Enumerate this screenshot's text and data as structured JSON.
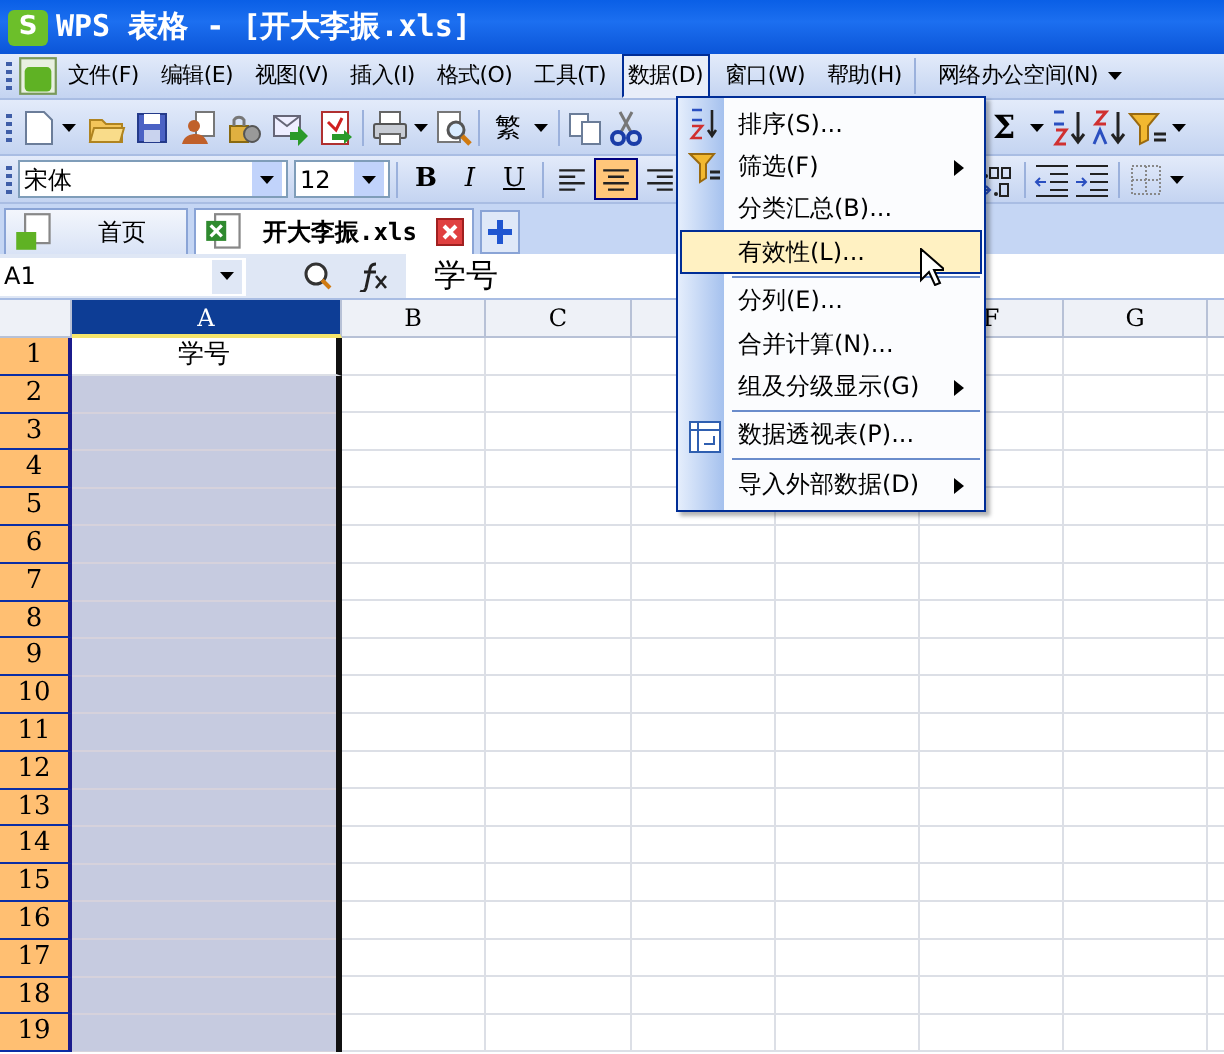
{
  "window": {
    "logo": "S",
    "title": "WPS 表格 - [开大李振.xls]"
  },
  "menu_bar": [
    {
      "label": "文件(F)",
      "selected": false
    },
    {
      "label": "编辑(E)",
      "selected": false
    },
    {
      "label": "视图(V)",
      "selected": false
    },
    {
      "label": "插入(I)",
      "selected": false
    },
    {
      "label": "格式(O)",
      "selected": false
    },
    {
      "label": "工具(T)",
      "selected": false
    },
    {
      "label": "数据(D)",
      "selected": true
    },
    {
      "label": "窗口(W)",
      "selected": false
    },
    {
      "label": "帮助(H)",
      "selected": false
    },
    {
      "label": "网络办公空间(N)",
      "selected": false
    }
  ],
  "standard_toolbar": {
    "traditional": "繁",
    "sum": "Σ"
  },
  "format_toolbar": {
    "font": "宋体",
    "size": "12",
    "buttons": [
      {
        "kind": "bold",
        "label": "B",
        "selected": false
      },
      {
        "kind": "italic",
        "label": "I",
        "selected": false
      },
      {
        "kind": "underline",
        "label": "U",
        "selected": false
      },
      {
        "kind": "align-left",
        "selected": false
      },
      {
        "kind": "align-center",
        "selected": true
      },
      {
        "kind": "align-right",
        "selected": false
      }
    ]
  },
  "tabs": [
    {
      "label": "首页",
      "selected": false,
      "kind": "home"
    },
    {
      "label": "开大李振.xls",
      "selected": true,
      "kind": "sheet"
    }
  ],
  "formula_bar": {
    "cell": "A1",
    "value": "学号"
  },
  "sheet": {
    "columns": [
      {
        "label": "A",
        "selected": true
      },
      {
        "label": "B",
        "selected": false
      },
      {
        "label": "C",
        "selected": false
      },
      {
        "kind": "blank"
      },
      {
        "kind": "covered"
      },
      {
        "label": "F",
        "selected": false
      },
      {
        "label": "G",
        "selected": false
      }
    ],
    "rows": [
      {
        "label": "1",
        "selected": true,
        "cells": [
          "学号"
        ]
      },
      {
        "label": "2",
        "selected": true
      },
      {
        "label": "3",
        "selected": true
      },
      {
        "label": "4",
        "selected": true
      },
      {
        "label": "5",
        "selected": true
      },
      {
        "label": "6",
        "selected": true
      },
      {
        "label": "7",
        "selected": true
      },
      {
        "label": "8",
        "selected": true
      },
      {
        "label": "9",
        "selected": true
      },
      {
        "label": "10",
        "selected": true
      },
      {
        "label": "11",
        "selected": true
      },
      {
        "label": "12",
        "selected": true
      },
      {
        "label": "13",
        "selected": true
      },
      {
        "label": "14",
        "selected": true
      },
      {
        "label": "15",
        "selected": true
      },
      {
        "label": "16",
        "selected": true
      },
      {
        "label": "17",
        "selected": true
      },
      {
        "label": "18",
        "selected": true
      },
      {
        "label": "19",
        "selected": true
      }
    ]
  },
  "data_menu": [
    {
      "label": "排序(S)...",
      "kind": "sort",
      "submenu": false,
      "separator_before": false,
      "selected": false
    },
    {
      "label": "筛选(F)",
      "kind": "filter",
      "submenu": true,
      "separator_before": false,
      "selected": false
    },
    {
      "label": "分类汇总(B)...",
      "kind": "plain",
      "submenu": false,
      "separator_before": false,
      "selected": false
    },
    {
      "label": "有效性(L)...",
      "kind": "plain",
      "submenu": false,
      "separator_before": false,
      "selected": true
    },
    {
      "label": "分列(E)...",
      "kind": "plain",
      "submenu": false,
      "separator_before": true,
      "selected": false
    },
    {
      "label": "合并计算(N)...",
      "kind": "plain",
      "submenu": false,
      "separator_before": false,
      "selected": false
    },
    {
      "label": "组及分级显示(G)",
      "kind": "plain",
      "submenu": true,
      "separator_before": false,
      "selected": false
    },
    {
      "label": "数据透视表(P)...",
      "kind": "pivot",
      "submenu": false,
      "separator_before": true,
      "selected": false
    },
    {
      "label": "导入外部数据(D)",
      "kind": "plain",
      "submenu": true,
      "separator_before": true,
      "selected": false
    }
  ]
}
